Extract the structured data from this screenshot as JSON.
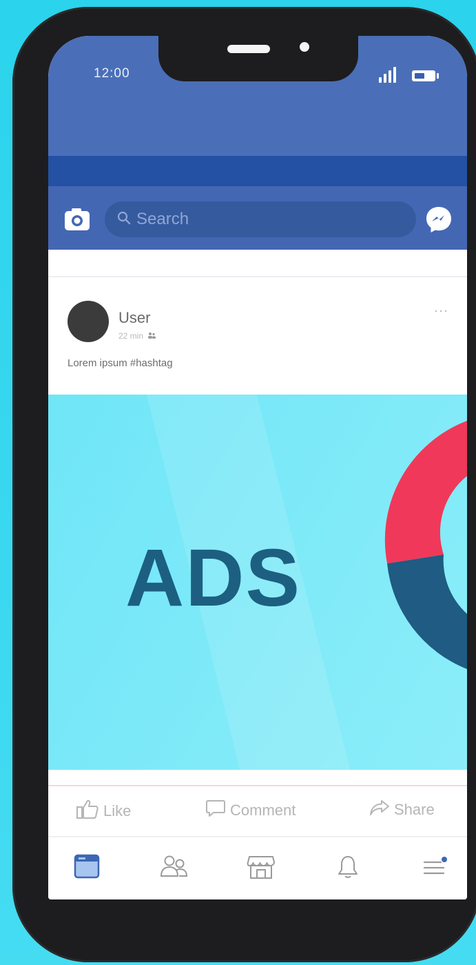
{
  "status_bar": {
    "time": "12:00"
  },
  "search": {
    "placeholder": "Search"
  },
  "post": {
    "user_name": "User",
    "meta": "22 min",
    "text": "Lorem ipsum #hashtag"
  },
  "ad": {
    "text": "ADS"
  },
  "actions": [
    {
      "label": "Like",
      "icon": "thumbs-up-icon"
    },
    {
      "label": "Comment",
      "icon": "comment-icon"
    },
    {
      "label": "Share",
      "icon": "share-icon"
    }
  ],
  "tabs": [
    {
      "name": "home",
      "icon": "home-icon"
    },
    {
      "name": "friends",
      "icon": "friends-icon"
    },
    {
      "name": "marketplace",
      "icon": "marketplace-icon"
    },
    {
      "name": "notifications",
      "icon": "bell-icon"
    },
    {
      "name": "menu",
      "icon": "menu-icon"
    }
  ],
  "colors": {
    "brand": "#4a6fb8",
    "brand_dark": "#2451a3",
    "background": "#2bd3ec",
    "ad_text": "#1d5f80",
    "ring_red": "#f0395a",
    "ring_blue": "#1f5b82"
  }
}
